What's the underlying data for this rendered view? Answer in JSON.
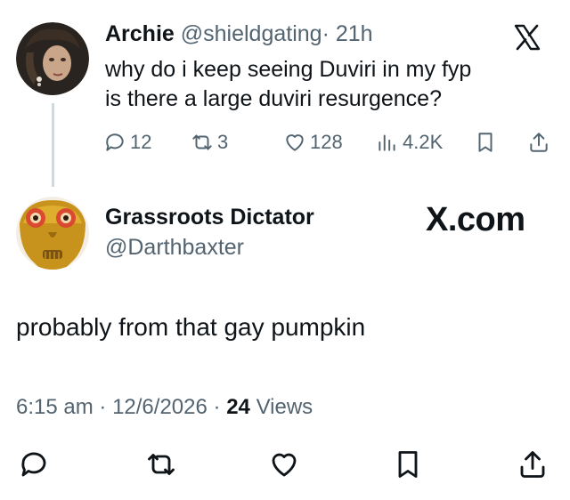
{
  "parent_tweet": {
    "author_name": "Archie",
    "handle": "@shieldgating",
    "separator": "·",
    "time": "21h",
    "line1": "why do i keep seeing Duviri in my fyp",
    "line2": "is there a large duviri resurgence?",
    "actions": {
      "replies": "12",
      "reposts": "3",
      "likes": "128",
      "views": "4.2K"
    }
  },
  "reply_tweet": {
    "author_name": "Grassroots Dictator",
    "handle": "@Darthbaxter",
    "watermark": "X.com",
    "text": "probably from that gay pumpkin",
    "time": "6:15 am",
    "sep1": "·",
    "date": "12/6/2026",
    "sep2": "·",
    "views_count": "24",
    "views_label": "Views"
  },
  "icons": {
    "logo": "x-logo-icon",
    "reply": "reply-icon",
    "repost": "repost-icon",
    "like": "heart-icon",
    "views": "views-bar-chart-icon",
    "bookmark": "bookmark-icon",
    "share": "share-icon"
  },
  "colors": {
    "text": "#0f1419",
    "muted": "#536471",
    "thread_line": "#cfd9de",
    "accent": "#1d9bf0"
  }
}
